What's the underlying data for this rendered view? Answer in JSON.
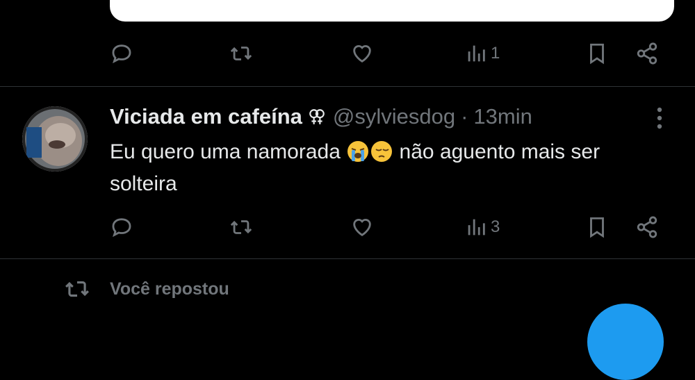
{
  "previous_post": {
    "actions": {
      "reply_icon": "reply-icon",
      "repost_icon": "repost-icon",
      "like_icon": "heart-icon",
      "views_icon": "views-icon",
      "views_count": "1",
      "bookmark_icon": "bookmark-icon",
      "share_icon": "share-icon"
    }
  },
  "post": {
    "display_name": "Viciada em cafeína",
    "badge_icon": "sapphic-symbol-icon",
    "handle": "@sylviesdog",
    "separator": "·",
    "time": "13min",
    "text_part1": "Eu quero uma namorada ",
    "emoji1": "loudly-crying-face-icon",
    "emoji2": "pensive-face-icon",
    "text_part2": " não aguento mais ser solteira",
    "actions": {
      "views_count": "3"
    }
  },
  "reposted_banner": {
    "icon": "repost-icon",
    "label": "Você repostou"
  },
  "colors": {
    "background": "#000000",
    "text": "#e7e9ea",
    "muted": "#71767b",
    "divider": "#2f3336",
    "accent": "#1d9bf0"
  }
}
